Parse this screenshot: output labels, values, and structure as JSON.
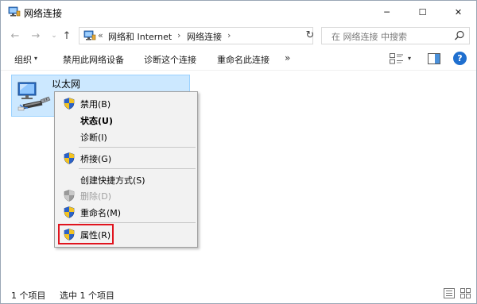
{
  "window": {
    "title": "网络连接",
    "controls": {
      "minimize": "─",
      "maximize": "☐",
      "close": "✕"
    }
  },
  "address": {
    "back": "←",
    "forward": "→",
    "recent": "⌄",
    "up": "↑",
    "overflow": "«",
    "crumbs": [
      "网络和 Internet",
      "网络连接"
    ],
    "separator": "›",
    "dropdown": "⌄",
    "refresh": "↻",
    "search_placeholder": "在 网络连接 中搜索"
  },
  "toolbar": {
    "organize": "组织",
    "organize_arrow": "▾",
    "disable": "禁用此网络设备",
    "diagnose": "诊断这个连接",
    "rename": "重命名此连接",
    "more": "»",
    "view_dropdown": "▾",
    "help": "?"
  },
  "content": {
    "items": [
      {
        "name": "以太网",
        "selected": true
      }
    ]
  },
  "context_menu": {
    "items": [
      {
        "label": "禁用(B)",
        "shield": true,
        "bold": false,
        "disabled": false
      },
      {
        "label": "状态(U)",
        "shield": false,
        "bold": true,
        "disabled": false
      },
      {
        "label": "诊断(I)",
        "shield": false,
        "bold": false,
        "disabled": false
      },
      {
        "label": "桥接(G)",
        "shield": true,
        "bold": false,
        "disabled": false
      },
      {
        "label": "创建快捷方式(S)",
        "shield": false,
        "bold": false,
        "disabled": false
      },
      {
        "label": "删除(D)",
        "shield": true,
        "bold": false,
        "disabled": true
      },
      {
        "label": "重命名(M)",
        "shield": true,
        "bold": false,
        "disabled": false
      },
      {
        "label": "属性(R)",
        "shield": true,
        "bold": false,
        "disabled": false,
        "highlighted": true
      }
    ],
    "highlight_color": "#e0141e"
  },
  "statusbar": {
    "count": "1 个项目",
    "selected": "选中 1 个项目"
  },
  "colors": {
    "selection_bg": "#cce8ff",
    "selection_border": "#99d1ff",
    "help_blue": "#1f6fcf",
    "menu_bg": "#f2f2f2"
  }
}
